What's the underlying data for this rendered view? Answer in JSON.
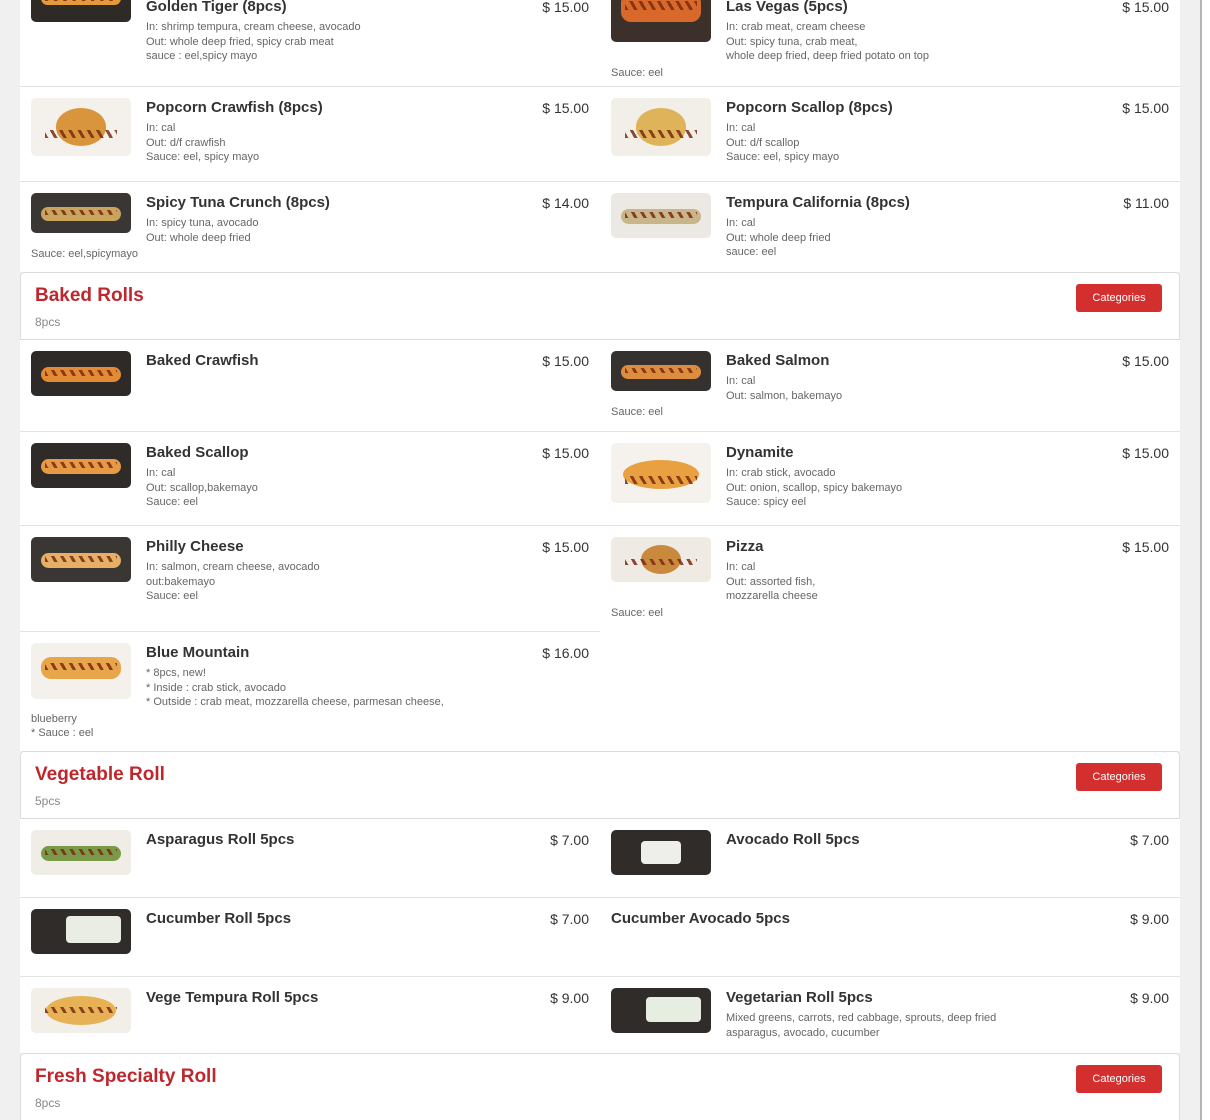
{
  "colors": {
    "accent": "#c0272d",
    "button": "#d32f2f"
  },
  "top_rows": [
    [
      {
        "name": "Golden Tiger (8pcs)",
        "price": "$ 15.00",
        "desc": [
          "In: shrimp tempura, cream cheese, avocado",
          "Out: whole deep fried, spicy crab meat",
          "sauce : eel,spicy mayo"
        ],
        "extra": []
      },
      {
        "name": "Las Vegas (5pcs)",
        "price": "$ 15.00",
        "desc": [
          "In: crab meat, cream cheese",
          "Out: spicy tuna, crab meat,",
          "whole deep fried, deep fried potato on top"
        ],
        "extra": [
          "Sauce: eel"
        ]
      }
    ],
    [
      {
        "name": "Popcorn Crawfish (8pcs)",
        "price": "$ 15.00",
        "desc": [
          "In: cal",
          "Out: d/f crawfish",
          "Sauce: eel, spicy mayo"
        ],
        "extra": []
      },
      {
        "name": "Popcorn Scallop (8pcs)",
        "price": "$ 15.00",
        "desc": [
          "In: cal",
          "Out: d/f scallop",
          "Sauce: eel, spicy mayo"
        ],
        "extra": []
      }
    ],
    [
      {
        "name": "Spicy Tuna Crunch (8pcs)",
        "price": "$ 14.00",
        "desc": [
          "In: spicy tuna, avocado",
          "Out: whole deep fried"
        ],
        "extra": [
          "Sauce: eel,spicymayo"
        ]
      },
      {
        "name": "Tempura California (8pcs)",
        "price": "$ 11.00",
        "desc": [
          "In: cal",
          "Out: whole deep fried",
          "sauce: eel"
        ],
        "extra": []
      }
    ]
  ],
  "sections": [
    {
      "title": "Baked Rolls",
      "subtitle": "8pcs",
      "button": "Categories",
      "rows": [
        [
          {
            "name": "Baked Crawfish",
            "price": "$ 15.00",
            "desc": [],
            "extra": []
          },
          {
            "name": "Baked Salmon",
            "price": "$ 15.00",
            "desc": [
              "In: cal",
              "Out: salmon, bakemayo"
            ],
            "extra": [
              "Sauce: eel"
            ]
          }
        ],
        [
          {
            "name": "Baked Scallop",
            "price": "$ 15.00",
            "desc": [
              "In: cal",
              "Out: scallop,bakemayo",
              "Sauce: eel"
            ],
            "extra": []
          },
          {
            "name": "Dynamite",
            "price": "$ 15.00",
            "desc": [
              "In: crab stick, avocado",
              "Out: onion, scallop, spicy bakemayo",
              "Sauce: spicy eel"
            ],
            "extra": []
          }
        ],
        [
          {
            "name": "Philly Cheese",
            "price": "$ 15.00",
            "desc": [
              "In: salmon, cream cheese, avocado",
              "out:bakemayo",
              "Sauce: eel"
            ],
            "extra": []
          },
          {
            "name": "Pizza",
            "price": "$ 15.00",
            "desc": [
              "In: cal",
              "Out: assorted fish,",
              "mozzarella cheese"
            ],
            "extra": [
              "Sauce: eel"
            ]
          }
        ],
        [
          {
            "name": "Blue Mountain",
            "price": "$ 16.00",
            "desc": [
              "* 8pcs, new!",
              "* Inside : crab stick, avocado",
              "* Outside : crab meat, mozzarella cheese, parmesan cheese,"
            ],
            "extra": [
              "blueberry",
              "* Sauce : eel"
            ]
          }
        ]
      ]
    },
    {
      "title": "Vegetable Roll",
      "subtitle": "5pcs",
      "button": "Categories",
      "rows": [
        [
          {
            "name": "Asparagus Roll 5pcs",
            "price": "$ 7.00",
            "desc": [],
            "extra": []
          },
          {
            "name": "Avocado Roll 5pcs",
            "price": "$ 7.00",
            "desc": [],
            "extra": []
          }
        ],
        [
          {
            "name": "Cucumber Roll 5pcs",
            "price": "$ 7.00",
            "desc": [],
            "extra": []
          },
          {
            "name": "Cucumber Avocado 5pcs",
            "price": "$ 9.00",
            "desc": [],
            "extra": []
          }
        ],
        [
          {
            "name": "Vege Tempura Roll 5pcs",
            "price": "$ 9.00",
            "desc": [],
            "extra": []
          },
          {
            "name": "Vegetarian Roll 5pcs",
            "price": "$ 9.00",
            "desc": [
              "Mixed greens, carrots, red cabbage, sprouts, deep fried",
              "asparagus, avocado, cucumber"
            ],
            "extra": []
          }
        ]
      ]
    },
    {
      "title": "Fresh Specialty Roll",
      "subtitle": "8pcs",
      "button": "Categories",
      "rows": []
    }
  ]
}
